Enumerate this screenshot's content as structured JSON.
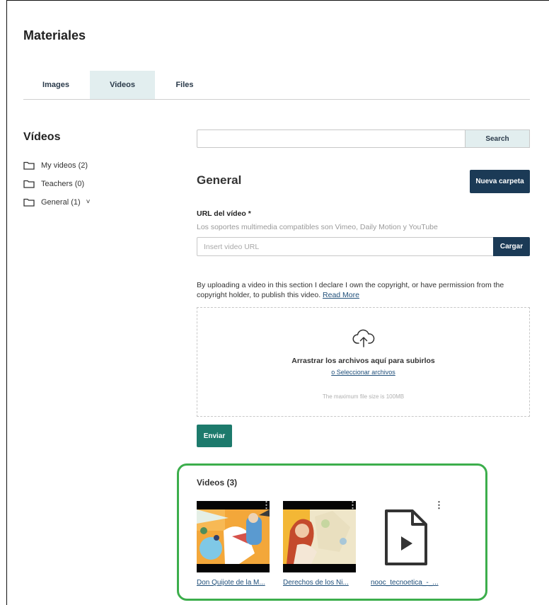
{
  "page": {
    "title": "Materiales"
  },
  "tabs": [
    {
      "label": "Images",
      "active": false
    },
    {
      "label": "Videos",
      "active": true
    },
    {
      "label": "Files",
      "active": false
    }
  ],
  "sidebar": {
    "title": "Vídeos",
    "folders": [
      {
        "label": "My videos (2)",
        "icon": "folder-icon"
      },
      {
        "label": "Teachers (0)",
        "icon": "folder-icon"
      },
      {
        "label": "General (1)",
        "icon": "folder-icon",
        "chevron": "˅"
      }
    ]
  },
  "search": {
    "placeholder": "",
    "button_label": "Search"
  },
  "main": {
    "title": "General",
    "new_folder_label": "Nueva carpeta",
    "url_label": "URL del vídeo *",
    "url_help": "Los soportes multimedia compatibles son Vimeo, Daily Motion y YouTube",
    "url_placeholder": "Insert video URL",
    "load_label": "Cargar",
    "declaration_text": "By uploading a video in this section I declare I own the copyright, or have permission from the copyright holder, to publish this video.",
    "read_more_label": "Read More",
    "dropzone": {
      "icon": "cloud-upload-icon",
      "main_text": "Arrastrar los archivos aquí para subirlos",
      "select_link": "o Seleccionar archivos",
      "max_size": "The maximum file size is 100MB"
    },
    "send_label": "Enviar"
  },
  "videos": {
    "title": "Videos (3)",
    "items": [
      {
        "label": "Don Quijote de la M...",
        "kind": "thumbnail",
        "menu": "⋮"
      },
      {
        "label": "Derechos de los Ni...",
        "kind": "thumbnail",
        "menu": "⋮"
      },
      {
        "label": "nooc_tecnoetica_-_...",
        "kind": "file-video-icon",
        "menu": "⋮"
      }
    ]
  },
  "colors": {
    "primary_dark": "#1b3a56",
    "send_green": "#1d7a6c",
    "tab_active_bg": "#e2eeef",
    "highlight_green": "#3cae4c",
    "link_blue": "#1f4f7a"
  }
}
